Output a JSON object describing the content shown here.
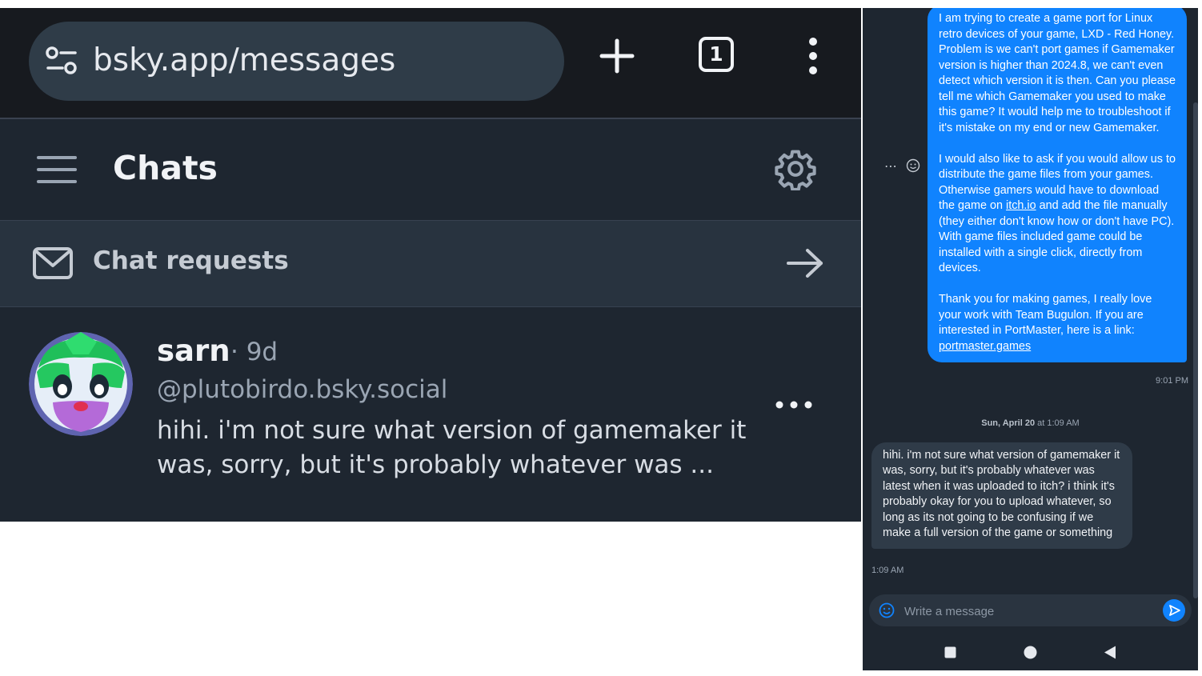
{
  "browser": {
    "url": "bsky.app/messages",
    "tab_count": "1"
  },
  "chats": {
    "title": "Chats",
    "requests_label": "Chat requests",
    "conversation": {
      "name": "sarn",
      "time": "· 9d",
      "handle": "@plutobirdo.bsky.social",
      "preview": "hihi. i'm not sure what version of gamemaker it was, sorry, but it's probably whatever was ..."
    }
  },
  "thread": {
    "sent": {
      "para1": "I am trying to create a game port for Linux retro devices of your game, LXD - Red Honey. Problem is we can't port games if Gamemaker version is higher than 2024.8, we can't even detect which version it is then. Can you please tell me which Gamemaker you used to make this game? It would help me to troubleshoot if it's mistake on my end or new Gamemaker.",
      "para2_a": "I would also like to ask if you would allow us to distribute the game files from your games. Otherwise gamers would have to download the game on ",
      "para2_link": "itch.io",
      "para2_b": " and add the file manually (they either don't know how or don't have PC). With game files included game could be installed with a single click, directly from devices.",
      "para3": "Thank you for making games, I really love your work with Team Bugulon. If you are interested in PortMaster, here is a link: ",
      "para3_link": "portmaster.games",
      "time": "9:01 PM"
    },
    "date_separator": {
      "date": "Sun, April 20",
      "time": " at 1:09 AM"
    },
    "received": {
      "text": "hihi. i'm not sure what version of gamemaker it was, sorry, but it's probably whatever was latest when it was uploaded to itch? i think it's probably okay for you to upload whatever, so long as its not going to be confusing if we make a full version of the game or something",
      "time": "1:09 AM"
    },
    "composer": {
      "placeholder": "Write a message"
    }
  },
  "colors": {
    "accent": "#1083fe",
    "background": "#1e2630",
    "topbar": "#171a1f"
  }
}
